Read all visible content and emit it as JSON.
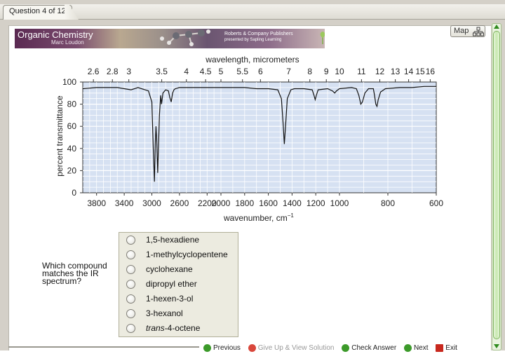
{
  "tab": {
    "label": "Question 4 of 12"
  },
  "banner": {
    "title": "Organic Chemistry",
    "author": "Marc Loudon",
    "publisher_line1": "Roberts & Company Publishers",
    "publisher_line2": "presented by Sapling Learning"
  },
  "map_button": {
    "label": "Map"
  },
  "chart_data": {
    "type": "line",
    "top_axis_label": "wavelength, micrometers",
    "top_ticks": [
      "2.6",
      "2.8",
      "3",
      "3.5",
      "4",
      "4.5",
      "5",
      "5.5",
      "6",
      "7",
      "8",
      "9",
      "10",
      "11",
      "12",
      "13",
      "14",
      "15",
      "16"
    ],
    "bottom_ticks": [
      "3800",
      "3400",
      "3000",
      "2600",
      "2200",
      "2000",
      "1800",
      "1600",
      "1400",
      "1200",
      "1000",
      "800",
      "600"
    ],
    "ylabel": "percent transmittance",
    "y_ticks": [
      "0",
      "20",
      "40",
      "60",
      "80",
      "100"
    ],
    "xlabel": "wavenumber, cm",
    "xlabel_sup": "−1",
    "ylim": [
      0,
      100
    ],
    "xlim": [
      4000,
      600
    ],
    "colors": {
      "plot_bg": "#d6e1f2",
      "line": "#111111",
      "grid": "#ffffff"
    },
    "series": [
      {
        "values": [
          [
            4000,
            94
          ],
          [
            3800,
            95
          ],
          [
            3600,
            95
          ],
          [
            3500,
            95
          ],
          [
            3400,
            94
          ],
          [
            3300,
            93
          ],
          [
            3200,
            95
          ],
          [
            3100,
            93
          ],
          [
            3050,
            92
          ],
          [
            3000,
            82
          ],
          [
            2980,
            40
          ],
          [
            2962,
            10
          ],
          [
            2950,
            45
          ],
          [
            2940,
            60
          ],
          [
            2930,
            48
          ],
          [
            2915,
            18
          ],
          [
            2905,
            40
          ],
          [
            2890,
            70
          ],
          [
            2872,
            88
          ],
          [
            2860,
            80
          ],
          [
            2840,
            90
          ],
          [
            2800,
            93
          ],
          [
            2760,
            92
          ],
          [
            2740,
            86
          ],
          [
            2720,
            82
          ],
          [
            2700,
            90
          ],
          [
            2680,
            93
          ],
          [
            2660,
            94
          ],
          [
            2600,
            95
          ],
          [
            2500,
            95
          ],
          [
            2400,
            95
          ],
          [
            2300,
            95
          ],
          [
            2200,
            95
          ],
          [
            2100,
            95
          ],
          [
            2000,
            95
          ],
          [
            1900,
            95
          ],
          [
            1800,
            95
          ],
          [
            1700,
            94
          ],
          [
            1600,
            94
          ],
          [
            1520,
            93
          ],
          [
            1490,
            85
          ],
          [
            1475,
            62
          ],
          [
            1465,
            44
          ],
          [
            1455,
            60
          ],
          [
            1440,
            85
          ],
          [
            1410,
            93
          ],
          [
            1380,
            94
          ],
          [
            1300,
            94
          ],
          [
            1230,
            93
          ],
          [
            1215,
            88
          ],
          [
            1205,
            84
          ],
          [
            1195,
            88
          ],
          [
            1180,
            93
          ],
          [
            1100,
            94
          ],
          [
            1060,
            92
          ],
          [
            1040,
            90
          ],
          [
            1025,
            92
          ],
          [
            1000,
            94
          ],
          [
            950,
            95
          ],
          [
            930,
            94
          ],
          [
            920,
            88
          ],
          [
            912,
            80
          ],
          [
            905,
            82
          ],
          [
            895,
            90
          ],
          [
            880,
            94
          ],
          [
            860,
            94
          ],
          [
            855,
            88
          ],
          [
            850,
            80
          ],
          [
            845,
            78
          ],
          [
            840,
            84
          ],
          [
            830,
            91
          ],
          [
            810,
            94
          ],
          [
            750,
            95
          ],
          [
            700,
            95
          ],
          [
            650,
            96
          ],
          [
            600,
            96
          ]
        ]
      }
    ],
    "grid": true
  },
  "question": {
    "text": "Which compound matches the IR spectrum?"
  },
  "choices": [
    {
      "label": "1,5-hexadiene"
    },
    {
      "label": "1-methylcyclopentene"
    },
    {
      "label": "cyclohexane"
    },
    {
      "label": "dipropyl ether"
    },
    {
      "label": "1-hexen-3-ol"
    },
    {
      "label": "3-hexanol"
    },
    {
      "label_prefix": "trans",
      "label_suffix": "-4-octene"
    }
  ],
  "nav": {
    "previous": "Previous",
    "give_up": "Give Up & View Solution",
    "check_answer": "Check Answer",
    "next": "Next",
    "exit": "Exit"
  }
}
